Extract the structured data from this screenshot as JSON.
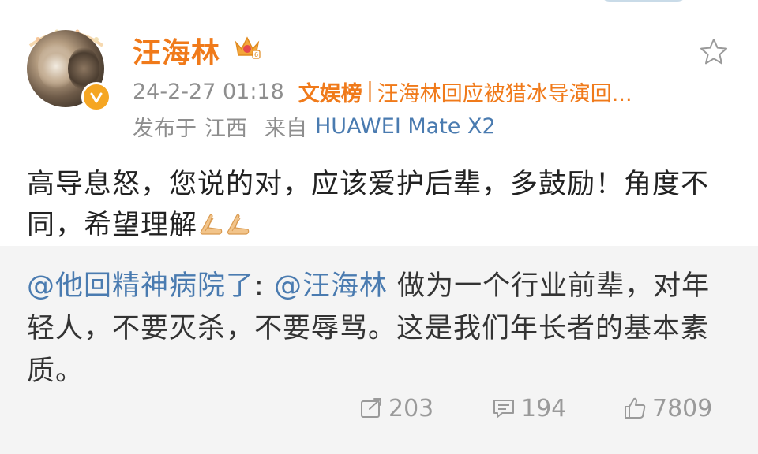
{
  "post": {
    "author": "汪海林",
    "time": "24-2-27 01:18",
    "hot_label": "文娱榜",
    "hot_topic": "汪海林回应被猎冰导演回...",
    "location_prefix": "发布于",
    "location": "江西",
    "source_prefix": "来自",
    "device": "HUAWEI Mate X2",
    "text": "高导息怒，您说的对，应该爱护后辈，多鼓励！角度不同，希望理解"
  },
  "quoted": {
    "mention_user": "@他回精神病院了",
    "colon": ": ",
    "mention_target": "@汪海林",
    "text": " 做为一个行业前辈，对年轻人，不要灭杀，不要辱骂。这是我们年长者的基本素质。"
  },
  "actions": {
    "repost_count": "203",
    "comment_count": "194",
    "like_count": "7809"
  },
  "icons": {
    "verified": "verified-badge-icon",
    "crown": "crown-member-icon",
    "star": "star-icon",
    "repost": "repost-icon",
    "comment": "comment-icon",
    "like": "thumbs-up-icon",
    "pray": "folded-hands-emoji"
  },
  "colors": {
    "accent_orange": "#f07a1a",
    "link_blue": "#4a7bb0",
    "muted_gray": "#8e8e8e",
    "quote_bg": "#f4f4f4"
  }
}
